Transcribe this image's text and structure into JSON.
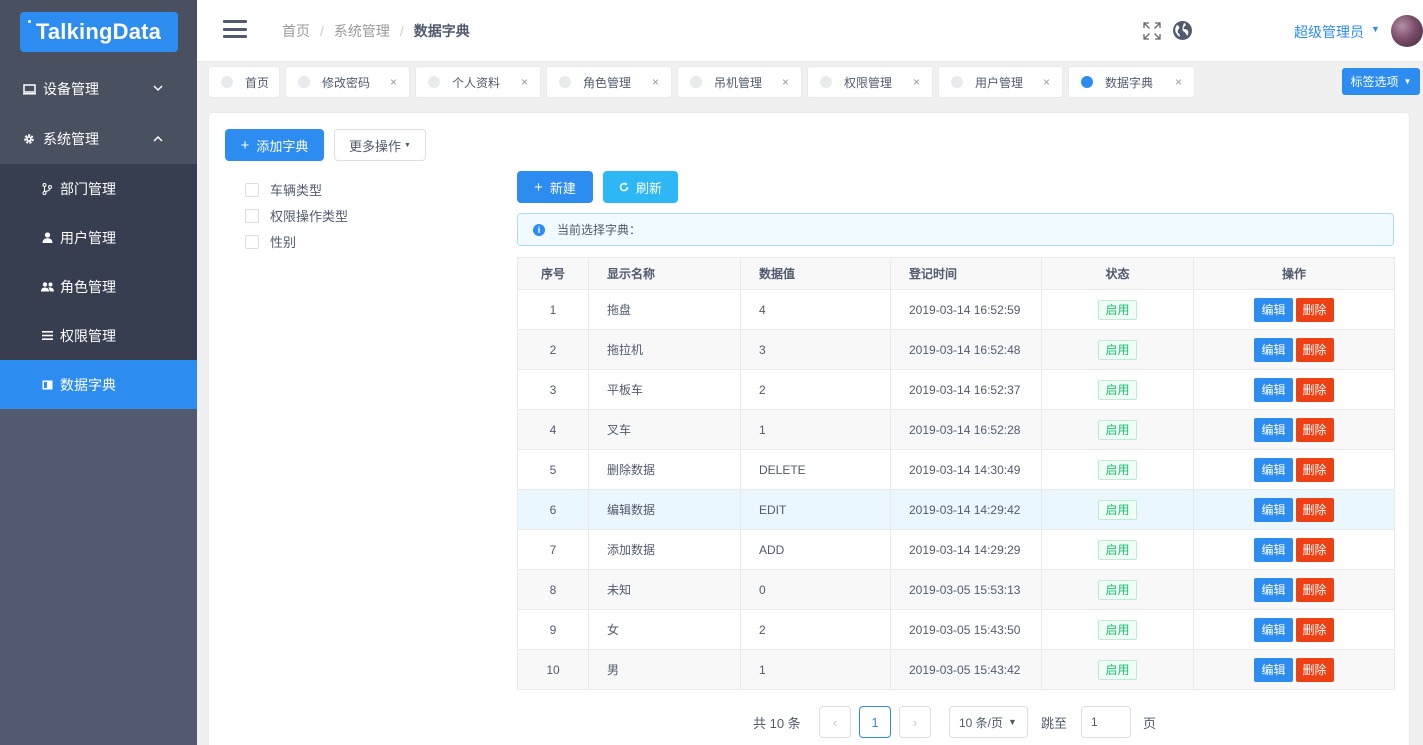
{
  "logo": {
    "text": "TalkingData"
  },
  "sidebar": {
    "groups": [
      {
        "label": "设备管理",
        "icon": "laptop-icon",
        "arrow": "chevron-down-icon"
      },
      {
        "label": "系统管理",
        "icon": "gear-icon",
        "arrow": "chevron-up-icon"
      }
    ],
    "sub_items": [
      {
        "label": "部门管理",
        "icon": "branch-icon"
      },
      {
        "label": "用户管理",
        "icon": "person-icon"
      },
      {
        "label": "角色管理",
        "icon": "people-icon"
      },
      {
        "label": "权限管理",
        "icon": "list-icon"
      },
      {
        "label": "数据字典",
        "icon": "book-icon"
      }
    ]
  },
  "header": {
    "breadcrumb": [
      "首页",
      "系统管理",
      "数据字典"
    ],
    "separator": "/",
    "user_name": "超级管理员"
  },
  "tags": {
    "items": [
      {
        "label": "首页",
        "closable": false
      },
      {
        "label": "修改密码",
        "closable": true
      },
      {
        "label": "个人资料",
        "closable": true
      },
      {
        "label": "角色管理",
        "closable": true
      },
      {
        "label": "吊机管理",
        "closable": true
      },
      {
        "label": "权限管理",
        "closable": true
      },
      {
        "label": "用户管理",
        "closable": true
      },
      {
        "label": "数据字典",
        "closable": true,
        "active": true
      }
    ],
    "close_glyph": "×",
    "options_label": "标签选项"
  },
  "toolbar": {
    "add_dict_label": "添加字典",
    "more_actions_label": "更多操作",
    "new_label": "新建",
    "refresh_label": "刷新"
  },
  "tree": {
    "items": [
      "车辆类型",
      "权限操作类型",
      "性别"
    ]
  },
  "alert": {
    "text": "当前选择字典："
  },
  "table": {
    "headers": [
      "序号",
      "显示名称",
      "数据值",
      "登记时间",
      "状态",
      "操作"
    ],
    "rows": [
      {
        "index": "1",
        "name": "拖盘",
        "value": "4",
        "time": "2019-03-14 16:52:59",
        "status": "启用"
      },
      {
        "index": "2",
        "name": "拖拉机",
        "value": "3",
        "time": "2019-03-14 16:52:48",
        "status": "启用"
      },
      {
        "index": "3",
        "name": "平板车",
        "value": "2",
        "time": "2019-03-14 16:52:37",
        "status": "启用"
      },
      {
        "index": "4",
        "name": "叉车",
        "value": "1",
        "time": "2019-03-14 16:52:28",
        "status": "启用"
      },
      {
        "index": "5",
        "name": "删除数据",
        "value": "DELETE",
        "time": "2019-03-14 14:30:49",
        "status": "启用"
      },
      {
        "index": "6",
        "name": "编辑数据",
        "value": "EDIT",
        "time": "2019-03-14 14:29:42",
        "status": "启用"
      },
      {
        "index": "7",
        "name": "添加数据",
        "value": "ADD",
        "time": "2019-03-14 14:29:29",
        "status": "启用"
      },
      {
        "index": "8",
        "name": "未知",
        "value": "0",
        "time": "2019-03-05 15:53:13",
        "status": "启用"
      },
      {
        "index": "9",
        "name": "女",
        "value": "2",
        "time": "2019-03-05 15:43:50",
        "status": "启用"
      },
      {
        "index": "10",
        "name": "男",
        "value": "1",
        "time": "2019-03-05 15:43:42",
        "status": "启用"
      }
    ],
    "edit_label": "编辑",
    "delete_label": "删除"
  },
  "pagination": {
    "total_text": "共 10 条",
    "current_page": "1",
    "page_size_label": "10 条/页",
    "jump_label": "跳至",
    "jump_value": "1",
    "page_unit": "页"
  },
  "colors": {
    "primary": "#2d8cf0",
    "sidebar": "#515a6e",
    "danger": "#ed4014",
    "success": "#19be6b",
    "info": "#2db7f5"
  }
}
